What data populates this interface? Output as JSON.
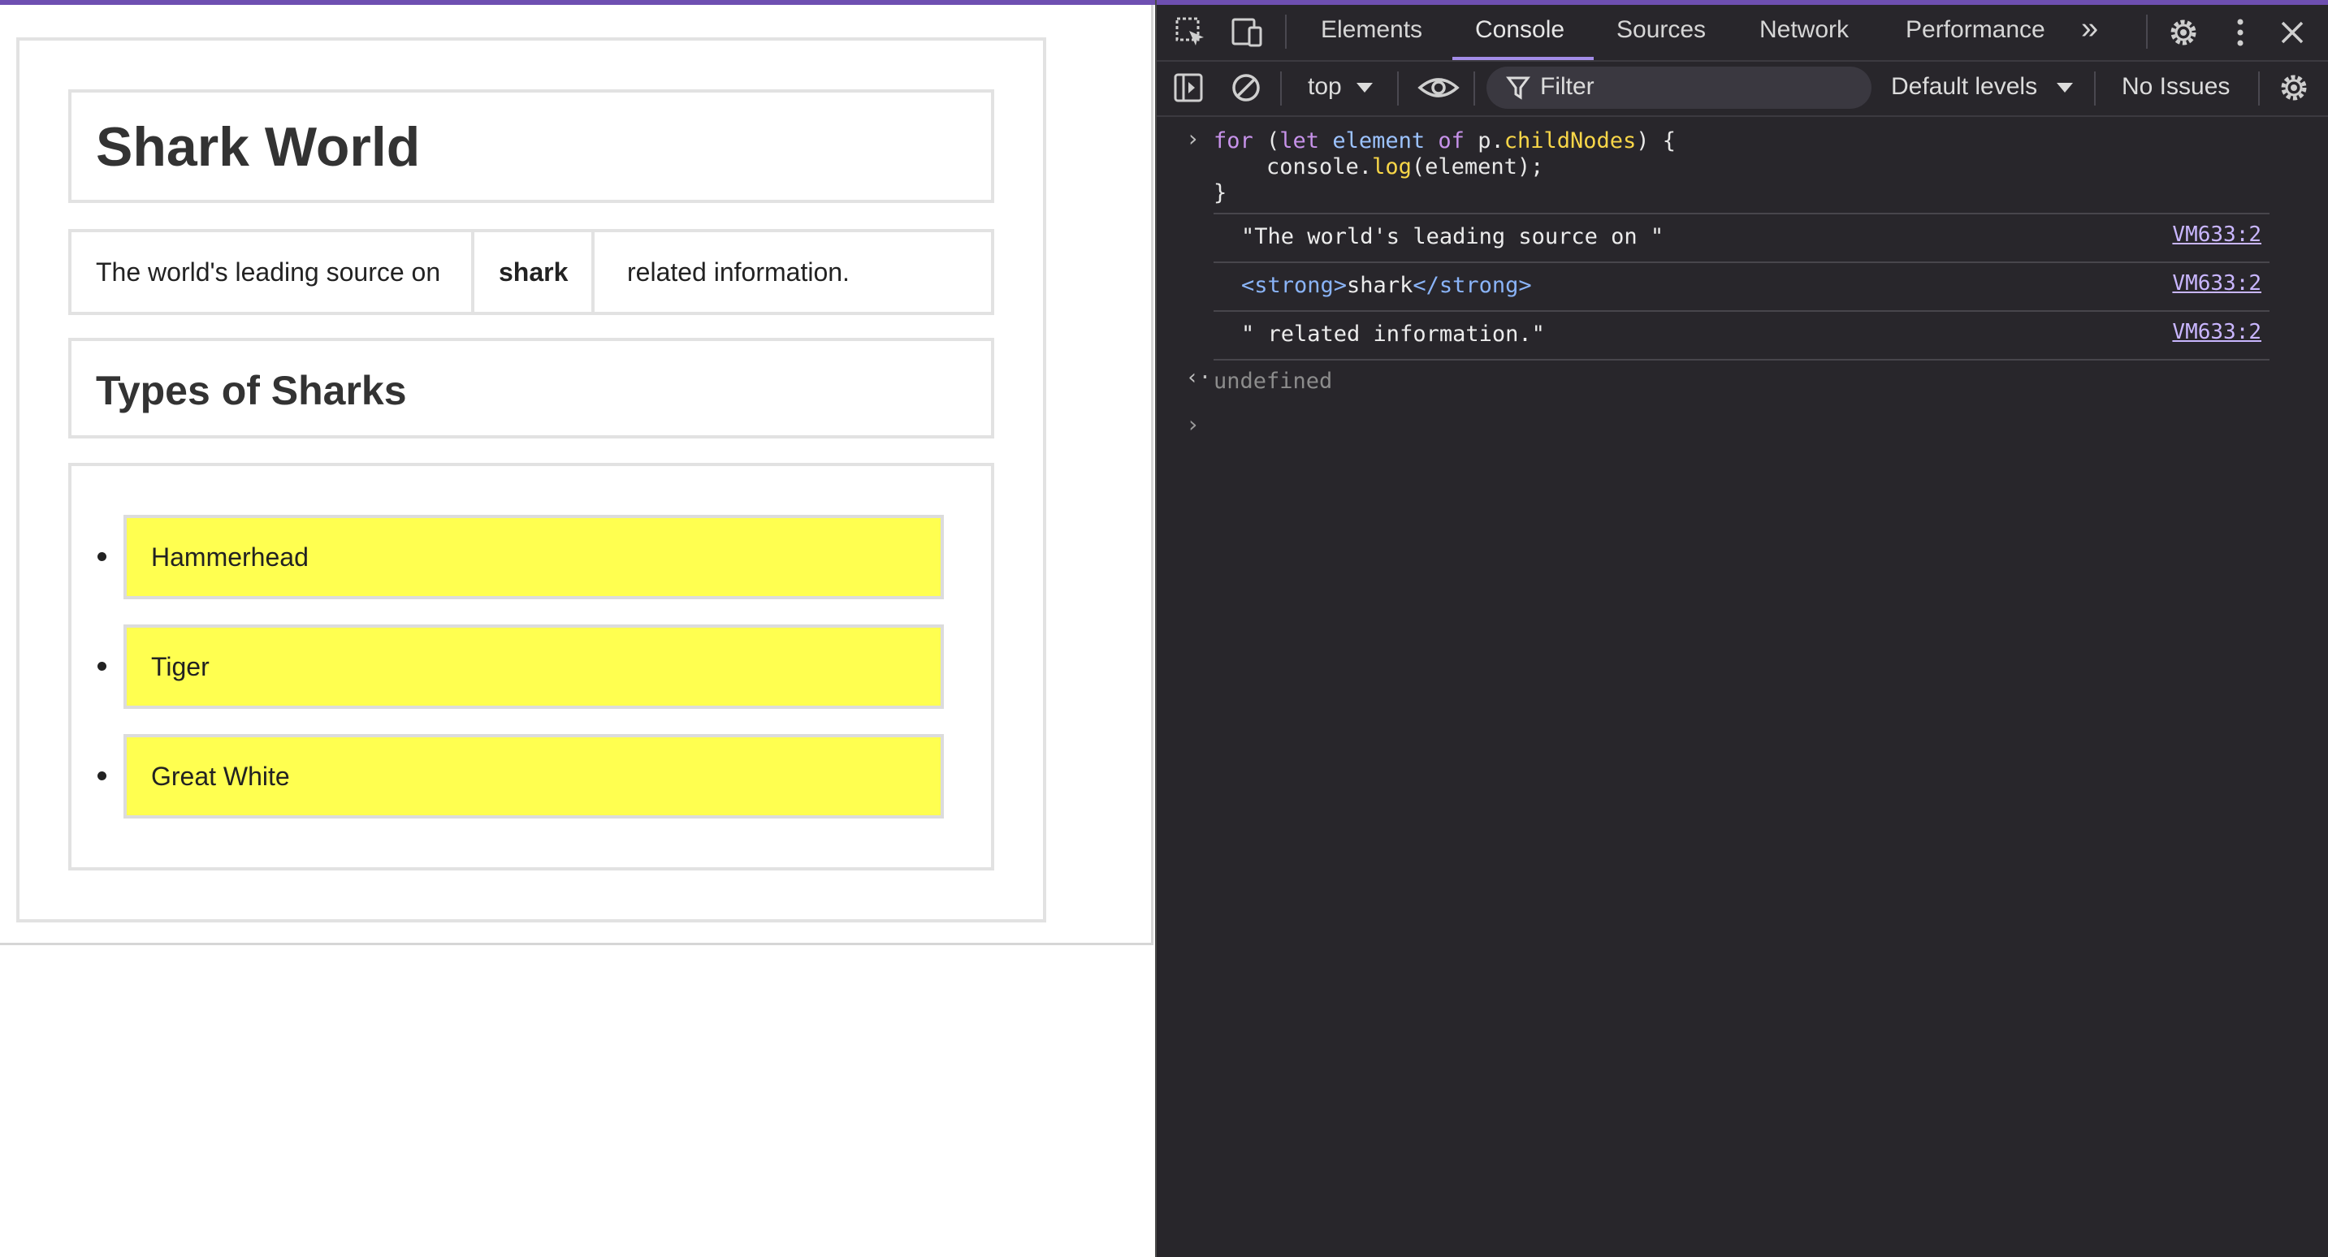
{
  "page": {
    "heading": "Shark World",
    "paragraph": {
      "text_before": "The world's leading source on",
      "strong": "shark",
      "text_after": "related information."
    },
    "subheading": "Types of Sharks",
    "list_items": [
      "Hammerhead",
      "Tiger",
      "Great White"
    ],
    "highlight_color": "#ffff50"
  },
  "devtools": {
    "tabs": [
      "Elements",
      "Console",
      "Sources",
      "Network",
      "Performance"
    ],
    "active_tab": "Console",
    "more_tabs": "»",
    "context": "top",
    "filter_placeholder": "Filter",
    "levels": "Default levels",
    "issues": "No Issues",
    "accent_color": "#a38ce8",
    "console": {
      "input": {
        "line1": {
          "for": "for",
          "paren": " (",
          "let": "let",
          "element": "element",
          "of": "of",
          "p": "p.",
          "childNodes": "childNodes",
          "end": ") {"
        },
        "line2": {
          "console": "    console.",
          "log": "log",
          "args": "(element);"
        },
        "line3": "}"
      },
      "outputs": [
        {
          "text": "\"The world's leading source on \"",
          "source": "VM633:2"
        },
        {
          "open_tag": "<strong>",
          "inner": "shark",
          "close_tag": "</strong>",
          "source": "VM633:2"
        },
        {
          "text": "\" related information.\"",
          "source": "VM633:2"
        }
      ],
      "return_value": "undefined"
    }
  }
}
